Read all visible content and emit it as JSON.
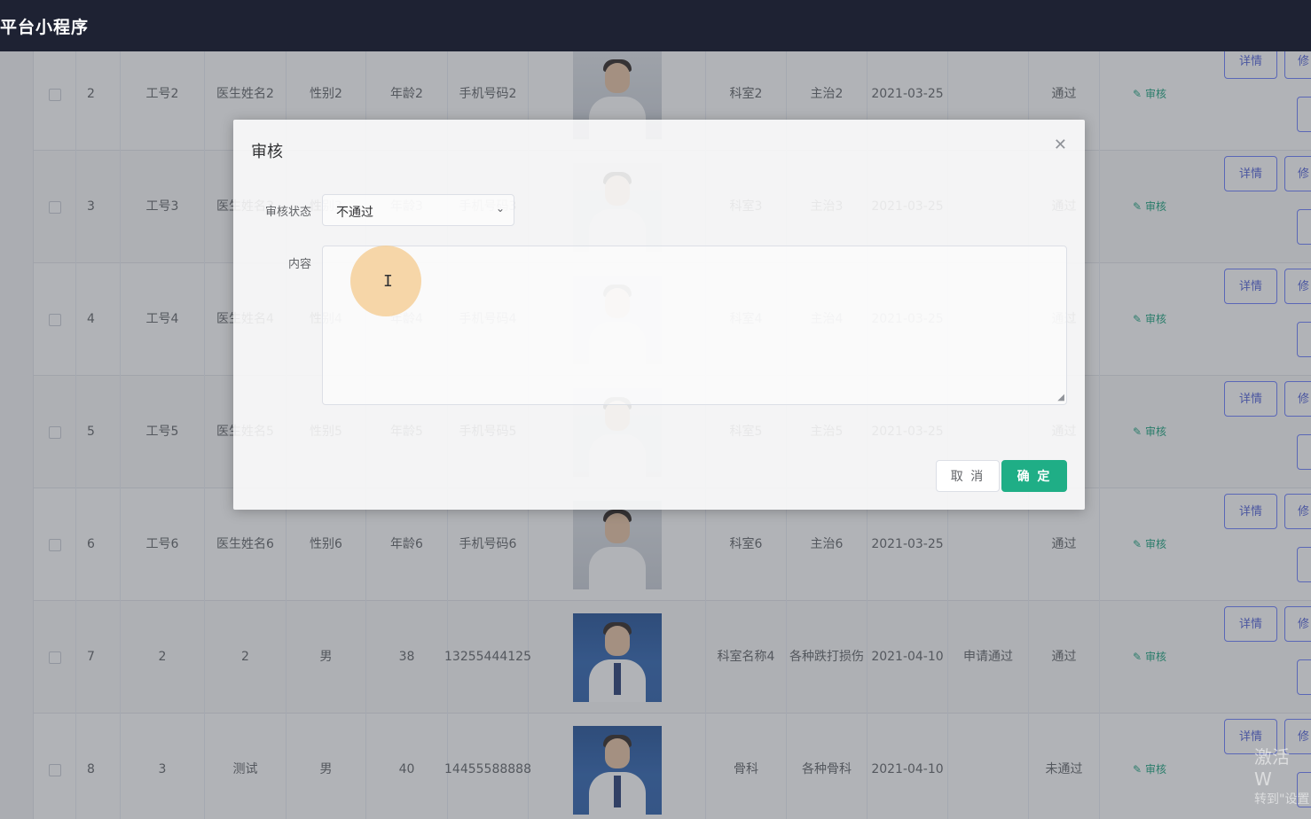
{
  "app": {
    "title": "平台小程序"
  },
  "rows": [
    {
      "index": "2",
      "job_no": "工号2",
      "name": "医生姓名2",
      "gender": "性别2",
      "age": "年龄2",
      "phone": "手机号码2",
      "dept": "科室2",
      "title": "主治2",
      "date": "2021-03-25",
      "reply": "",
      "status": "通过",
      "audit": "审核",
      "photo": "group"
    },
    {
      "index": "3",
      "job_no": "工号3",
      "name": "医生姓名3",
      "gender": "性别3",
      "age": "年龄3",
      "phone": "手机号码3",
      "dept": "科室3",
      "title": "主治3",
      "date": "2021-03-25",
      "reply": "",
      "status": "通过",
      "audit": "审核",
      "photo": "white"
    },
    {
      "index": "4",
      "job_no": "工号4",
      "name": "医生姓名4",
      "gender": "性别4",
      "age": "年龄4",
      "phone": "手机号码4",
      "dept": "科室4",
      "title": "主治4",
      "date": "2021-03-25",
      "reply": "",
      "status": "通过",
      "audit": "审核",
      "photo": "white"
    },
    {
      "index": "5",
      "job_no": "工号5",
      "name": "医生姓名5",
      "gender": "性别5",
      "age": "年龄5",
      "phone": "手机号码5",
      "dept": "科室5",
      "title": "主治5",
      "date": "2021-03-25",
      "reply": "",
      "status": "通过",
      "audit": "审核",
      "photo": "white"
    },
    {
      "index": "6",
      "job_no": "工号6",
      "name": "医生姓名6",
      "gender": "性别6",
      "age": "年龄6",
      "phone": "手机号码6",
      "dept": "科室6",
      "title": "主治6",
      "date": "2021-03-25",
      "reply": "",
      "status": "通过",
      "audit": "审核",
      "photo": "group"
    },
    {
      "index": "7",
      "job_no": "2",
      "name": "2",
      "gender": "男",
      "age": "38",
      "phone": "13255444125",
      "dept": "科室名称4",
      "title": "各种跌打损伤",
      "date": "2021-04-10",
      "reply": "申请通过",
      "status": "通过",
      "audit": "审核",
      "photo": "blue"
    },
    {
      "index": "8",
      "job_no": "3",
      "name": "测试",
      "gender": "男",
      "age": "40",
      "phone": "14455588888",
      "dept": "骨科",
      "title": "各种骨科",
      "date": "2021-04-10",
      "reply": "",
      "status": "未通过",
      "audit": "审核",
      "photo": "blue"
    }
  ],
  "row_buttons": {
    "detail": "详情",
    "edit": "修"
  },
  "dialog": {
    "title": "审核",
    "status_label": "审核状态",
    "status_value": "不通过",
    "content_label": "内容",
    "content_value": "",
    "cancel_label": "取 消",
    "confirm_label": "确 定"
  },
  "watermark": {
    "line1": "激活 W",
    "line2": "转到\"设置"
  },
  "colors": {
    "topbar": "#1e2233",
    "confirm": "#1fae86",
    "audit_link": "#19a27c",
    "button_border": "#6a7cff"
  }
}
